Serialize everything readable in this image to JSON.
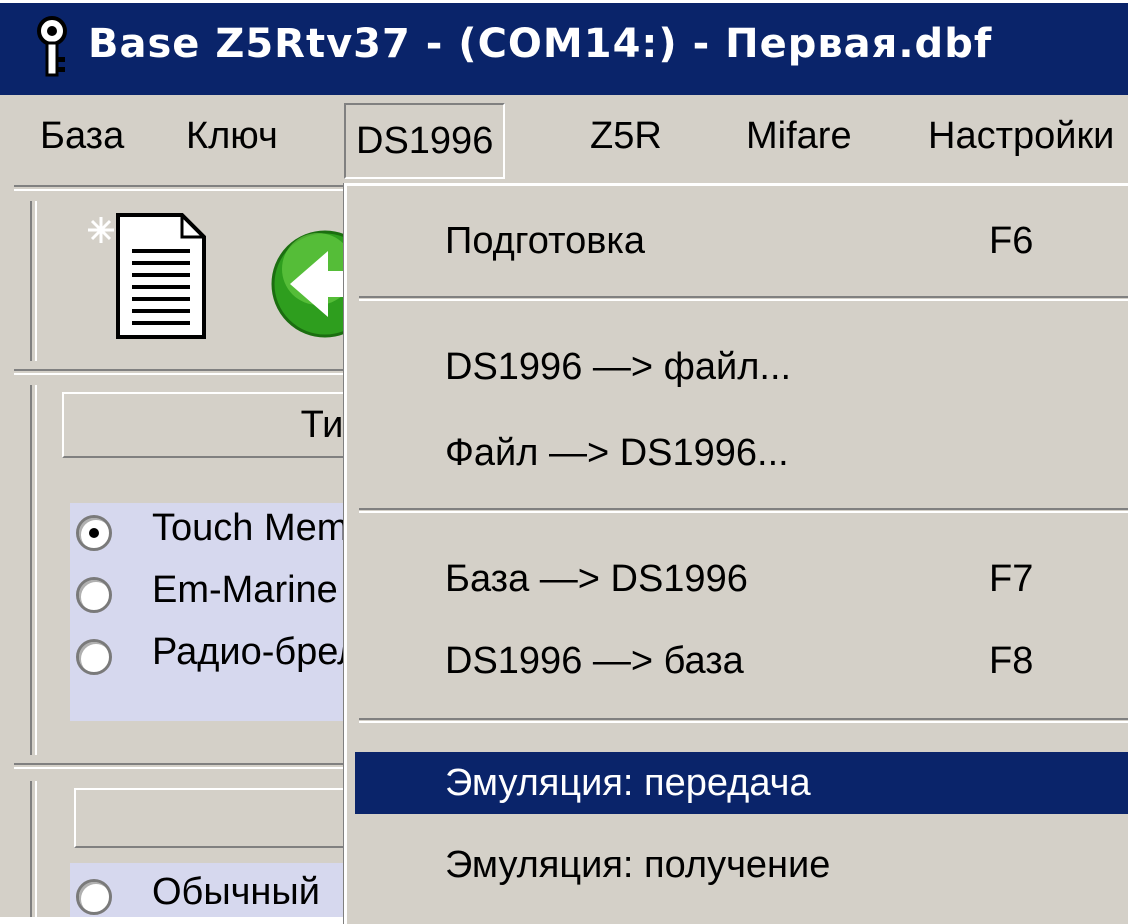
{
  "window": {
    "title": "Base Z5Rtv37 - (COM14:) - Первая.dbf",
    "icon": "key-icon"
  },
  "menubar": {
    "items": [
      {
        "label": "База"
      },
      {
        "label": "Ключ"
      },
      {
        "label": "DS1996",
        "open": true
      },
      {
        "label": "Z5R"
      },
      {
        "label": "Mifare"
      },
      {
        "label": "Настройки"
      }
    ]
  },
  "toolbar": {
    "new_icon": "new-document-icon",
    "back_icon": "green-back-arrow-icon"
  },
  "type_group": {
    "header": "Тип",
    "options": [
      {
        "label": "Touch Memory",
        "checked": true
      },
      {
        "label": "Em-Marine",
        "checked": false
      },
      {
        "label": "Радио-брелок",
        "checked": false
      }
    ]
  },
  "second_group": {
    "options": [
      {
        "label": "Обычный",
        "checked": false
      }
    ]
  },
  "dropdown": {
    "items": [
      {
        "label": "Подготовка",
        "shortcut": "F6"
      },
      {
        "label": "DS1996 —> файл...",
        "shortcut": ""
      },
      {
        "label": "Файл —> DS1996...",
        "shortcut": ""
      },
      {
        "label": "База —> DS1996",
        "shortcut": "F7"
      },
      {
        "label": "DS1996 —> база",
        "shortcut": "F8"
      },
      {
        "label": "Эмуляция: передача",
        "shortcut": "",
        "selected": true
      },
      {
        "label": "Эмуляция: получение",
        "shortcut": ""
      }
    ]
  },
  "colors": {
    "titlebar": "#0a246a",
    "face": "#d4d0c8",
    "highlight": "#0a246a",
    "radio_panel": "#d6d8ee"
  }
}
